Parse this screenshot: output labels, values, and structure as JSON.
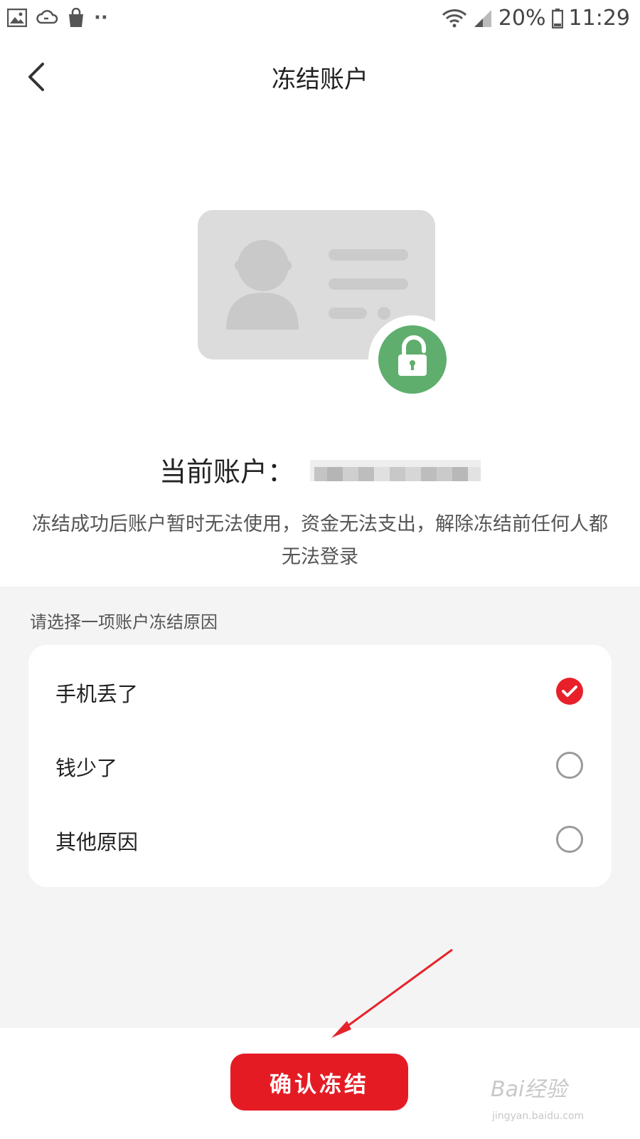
{
  "status_bar": {
    "battery_percent": "20%",
    "time": "11:29",
    "dots": "··"
  },
  "header": {
    "title": "冻结账户"
  },
  "account": {
    "label": "当前账户："
  },
  "description": "冻结成功后账户暂时无法使用，资金无法支出，解除冻结前任何人都无法登录",
  "reasons": {
    "title": "请选择一项账户冻结原因",
    "options": [
      {
        "label": "手机丢了",
        "selected": true
      },
      {
        "label": "钱少了",
        "selected": false
      },
      {
        "label": "其他原因",
        "selected": false
      }
    ]
  },
  "confirm_button": "确认冻结",
  "colors": {
    "accent": "#e51b24",
    "lock_green": "#5fae6e",
    "placeholder_grey": "#dcdcdc",
    "section_bg": "#f4f4f4"
  },
  "watermark": {
    "text": "Bai经验",
    "sub": "jingyan.baidu.com"
  }
}
